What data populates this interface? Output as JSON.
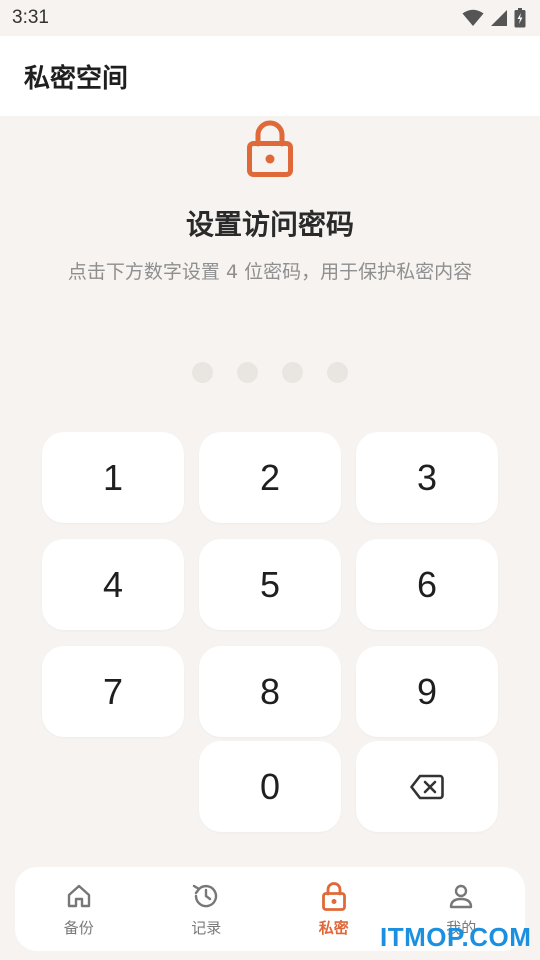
{
  "status_bar": {
    "time": "3:31"
  },
  "app_bar": {
    "title": "私密空间"
  },
  "setup": {
    "title": "设置访问密码",
    "description": "点击下方数字设置 4 位密码，用于保护私密内容",
    "pin_length": 4,
    "pin_entered": 0
  },
  "keypad": {
    "keys": [
      "1",
      "2",
      "3",
      "4",
      "5",
      "6",
      "7",
      "8",
      "9",
      "0"
    ],
    "backspace_icon": "backspace-icon"
  },
  "bottom_nav": {
    "items": [
      {
        "label": "备份",
        "icon": "home-icon",
        "active": false
      },
      {
        "label": "记录",
        "icon": "history-icon",
        "active": false
      },
      {
        "label": "私密",
        "icon": "lock-icon",
        "active": true
      },
      {
        "label": "我的",
        "icon": "person-icon",
        "active": false
      }
    ]
  },
  "colors": {
    "accent": "#e0693a",
    "background": "#f6f3f0",
    "surface": "#ffffff",
    "muted_text": "#8f8f8f",
    "watermark": "#1b8fe0"
  },
  "watermark": {
    "text": "ITMOP.COM"
  }
}
